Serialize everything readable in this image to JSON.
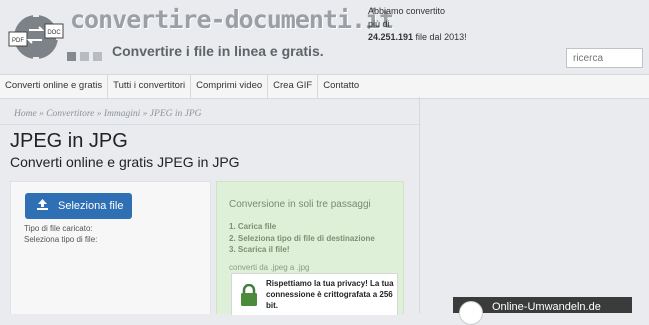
{
  "header": {
    "logo_title": "convertire-documenti.it",
    "logo_subtitle": "Convertire i file in linea e gratis.",
    "logo_badge_left": "PDF",
    "logo_badge_right": "DOC",
    "stats_line1": "Abbiamo convertito",
    "stats_line2": "più di",
    "stats_count": "24.251.191",
    "stats_suffix": " file dal 2013!",
    "search_placeholder": "ricerca"
  },
  "nav": {
    "items": [
      {
        "label": "Converti online e gratis"
      },
      {
        "label": "Tutti i convertitori"
      },
      {
        "label": "Comprimi video"
      },
      {
        "label": "Crea GIF"
      },
      {
        "label": "Contatto"
      }
    ]
  },
  "breadcrumb": "Home » Convertitore » Immagini » JPEG in JPG",
  "page": {
    "title": "JPEG in JPG",
    "subtitle": "Converti online e gratis JPEG in JPG"
  },
  "upload": {
    "button_label": "Seleziona file",
    "file_type_label": "Tipo di file caricato:",
    "select_type_label": "Seleziona tipo di file:"
  },
  "steps": {
    "title": "Conversione in soli tre passaggi",
    "items": [
      "1. Carica file",
      "2. Seleziona tipo di file di destinazione",
      "3. Scarica il file!"
    ],
    "note": "converti da .jpeg a .jpg",
    "privacy": "Rispettiamo la tua privacy! La tua connessione è crittografata a 256 bit."
  },
  "ad": {
    "text": "Online-Umwandeln.de"
  },
  "colors": {
    "accent_button": "#2f6fb3",
    "green_panel": "#dff0d8"
  }
}
